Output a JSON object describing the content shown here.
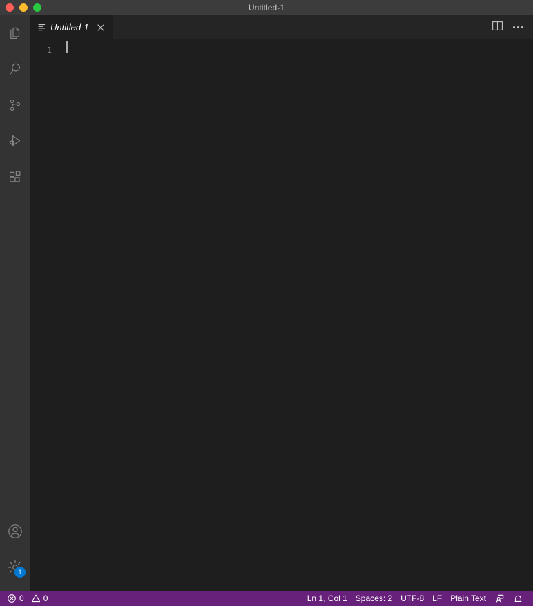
{
  "window": {
    "title": "Untitled-1",
    "controls": [
      {
        "name": "close",
        "color": "#ff5f57"
      },
      {
        "name": "minimize",
        "color": "#febc2e"
      },
      {
        "name": "maximize",
        "color": "#28c840"
      }
    ]
  },
  "activity_bar": {
    "items": [
      {
        "icon": "explorer-icon",
        "label": "Explorer",
        "badge": null
      },
      {
        "icon": "search-icon",
        "label": "Search",
        "badge": null
      },
      {
        "icon": "source-control-icon",
        "label": "Source Control",
        "badge": null
      },
      {
        "icon": "run-and-debug-icon",
        "label": "Run and Debug",
        "badge": null
      },
      {
        "icon": "extensions-icon",
        "label": "Extensions",
        "badge": null
      }
    ],
    "bottom_items": [
      {
        "icon": "account-icon",
        "label": "Accounts",
        "badge": null
      },
      {
        "icon": "gear-icon",
        "label": "Manage",
        "badge": "1"
      }
    ]
  },
  "tab_bar": {
    "tabs": [
      {
        "label": "Untitled-1",
        "icon": "plain-text-file-icon",
        "active": true,
        "dirty": false,
        "close": "×"
      }
    ],
    "actions": [
      {
        "icon": "split-editor-icon",
        "label": "Split Editor Right"
      },
      {
        "icon": "more-actions-icon",
        "label": "More Actions..."
      }
    ]
  },
  "editor": {
    "line_numbers": [
      "1"
    ],
    "lines": [
      ""
    ],
    "cursor": {
      "line": 1,
      "column": 1
    }
  },
  "status_bar": {
    "left": [
      {
        "name": "problems",
        "icon": "error-icon",
        "text": "0"
      },
      {
        "name": "warnings",
        "icon": "warning-icon",
        "text": "0"
      }
    ],
    "right": [
      {
        "name": "cursor-position",
        "text": "Ln 1, Col 1"
      },
      {
        "name": "indentation",
        "text": "Spaces: 2"
      },
      {
        "name": "encoding",
        "text": "UTF-8"
      },
      {
        "name": "eol",
        "text": "LF"
      },
      {
        "name": "language-mode",
        "text": "Plain Text"
      },
      {
        "name": "live-share",
        "icon": "live-share-icon",
        "text": ""
      },
      {
        "name": "notifications",
        "icon": "bell-icon",
        "text": ""
      }
    ],
    "background": "#68217a"
  },
  "colors": {
    "titlebar": "#3c3c3c",
    "activitybar": "#333333",
    "tabbar": "#252526",
    "editor": "#1e1e1e",
    "statusbar": "#68217a",
    "badge": "#0078d4",
    "icon": "#868686",
    "text": "#cccccc"
  }
}
